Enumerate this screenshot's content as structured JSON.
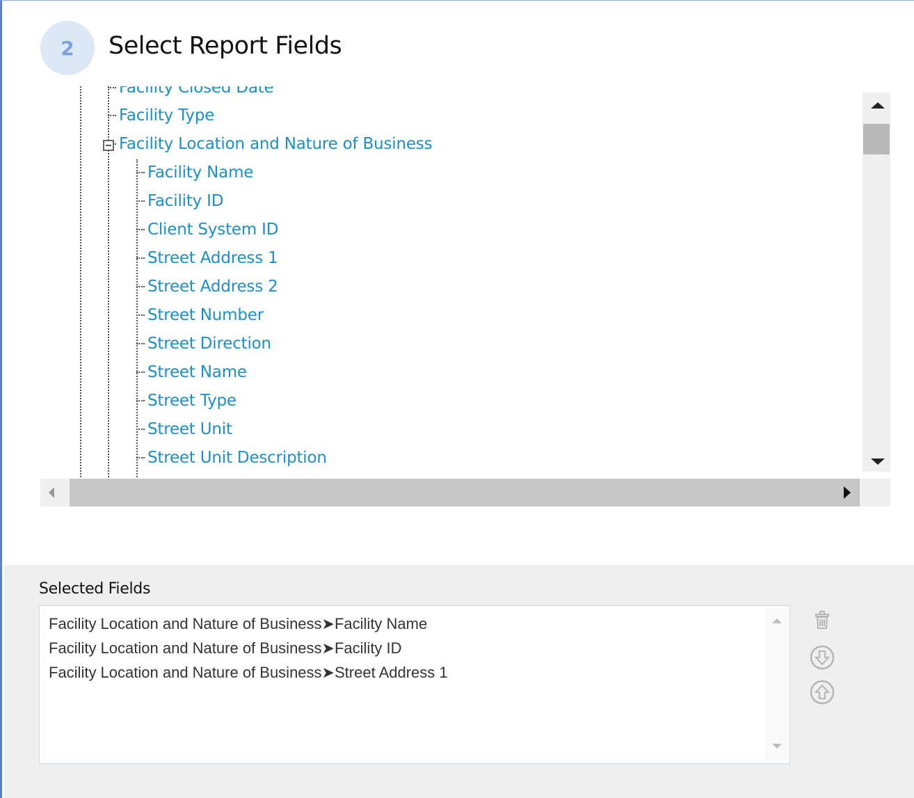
{
  "step": {
    "number": "2",
    "title": "Select Report Fields"
  },
  "tree": {
    "partial_item": "Facility Closed Date",
    "facility_type": "Facility Type",
    "group_label": "Facility Location and Nature of Business",
    "group_children": [
      "Facility Name",
      "Facility ID",
      "Client System ID",
      "Street Address 1",
      "Street Address 2",
      "Street Number",
      "Street Direction",
      "Street Name",
      "Street Type",
      "Street Unit",
      "Street Unit Description"
    ]
  },
  "selected": {
    "label": "Selected Fields",
    "separator": "➤",
    "items": [
      {
        "group": "Facility Location and Nature of Business",
        "field": "Facility Name"
      },
      {
        "group": "Facility Location and Nature of Business",
        "field": "Facility ID"
      },
      {
        "group": "Facility Location and Nature of Business",
        "field": "Street Address 1"
      }
    ]
  },
  "icons": {
    "delete": "trash-icon",
    "move_down": "arrow-down-circle-icon",
    "move_up": "arrow-up-circle-icon"
  },
  "colors": {
    "link": "#1a8fc9",
    "step_badge": "#dde8f7"
  }
}
